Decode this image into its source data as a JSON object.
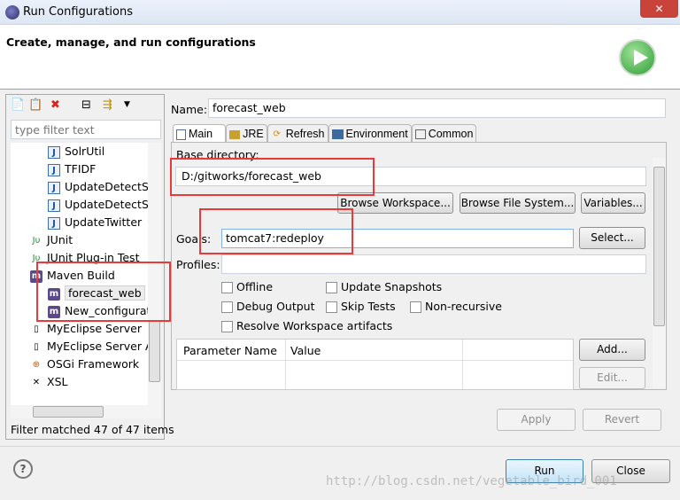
{
  "window": {
    "title": "Run Configurations",
    "close_label": "✕"
  },
  "header": {
    "subtitle": "Create, manage, and run configurations",
    "run_icon": "play-circle-icon"
  },
  "left": {
    "toolbar": [
      "new-config-icon",
      "duplicate-icon",
      "delete-icon",
      "collapse-all-icon",
      "filter-icon",
      "dropdown-icon"
    ],
    "filter_placeholder": "type filter text",
    "items": [
      {
        "label": "SolrUtil",
        "icon": "java-app-icon",
        "level": 2
      },
      {
        "label": "TFIDF",
        "icon": "java-app-icon",
        "level": 2
      },
      {
        "label": "UpdateDetectSe",
        "icon": "java-app-icon",
        "level": 2
      },
      {
        "label": "UpdateDetectSe",
        "icon": "java-app-icon",
        "level": 2
      },
      {
        "label": "UpdateTwitter",
        "icon": "java-app-icon",
        "level": 2
      },
      {
        "label": "JUnit",
        "icon": "junit-icon",
        "level": 1
      },
      {
        "label": "JUnit Plug-in Test",
        "icon": "junit-plugin-icon",
        "level": 1
      },
      {
        "label": "Maven Build",
        "icon": "maven-icon",
        "level": 1
      },
      {
        "label": "forecast_web",
        "icon": "maven-icon",
        "level": 2,
        "selected": true
      },
      {
        "label": "New_configurat",
        "icon": "maven-icon",
        "level": 2
      },
      {
        "label": "MyEclipse Server",
        "icon": "server-icon",
        "level": 1
      },
      {
        "label": "MyEclipse Server A",
        "icon": "server-app-icon",
        "level": 1
      },
      {
        "label": "OSGi Framework",
        "icon": "osgi-icon",
        "level": 1
      },
      {
        "label": "XSL",
        "icon": "xsl-icon",
        "level": 1
      }
    ],
    "status": "Filter matched 47 of 47 items"
  },
  "main": {
    "name_label": "Name:",
    "name_value": "forecast_web",
    "tabs": [
      {
        "label": "Main",
        "active": true
      },
      {
        "label": "JRE"
      },
      {
        "label": "Refresh"
      },
      {
        "label": "Environment"
      },
      {
        "label": "Common"
      }
    ],
    "base_dir_label": "Base directory:",
    "base_dir_value": "D:/gitworks/forecast_web",
    "browse_workspace": "Browse Workspace...",
    "browse_fs": "Browse File System...",
    "variables": "Variables...",
    "goals_label": "Goals:",
    "goals_value": "tomcat7:redeploy",
    "select": "Select...",
    "profiles_label": "Profiles:",
    "profiles_value": "",
    "checkboxes": [
      {
        "label": "Offline",
        "checked": false
      },
      {
        "label": "Update Snapshots",
        "checked": false
      },
      {
        "label": "Debug Output",
        "checked": false
      },
      {
        "label": "Skip Tests",
        "checked": false
      },
      {
        "label": "Non-recursive",
        "checked": false
      },
      {
        "label": "Resolve Workspace artifacts",
        "checked": false
      }
    ],
    "param_headers": [
      "Parameter Name",
      "Value"
    ],
    "add": "Add...",
    "edit": "Edit...",
    "apply": "Apply",
    "revert": "Revert"
  },
  "footer": {
    "help_icon": "help-icon",
    "run": "Run",
    "close": "Close",
    "watermark": "http://blog.csdn.net/vegetable_bird_001"
  },
  "colors": {
    "highlight_box": "#e83a3a",
    "run_icon": "#3cae3c"
  }
}
